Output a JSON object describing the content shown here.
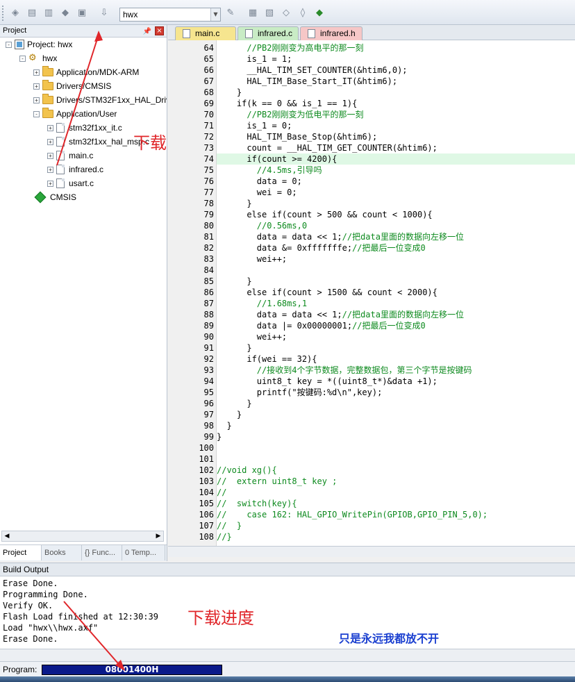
{
  "toolbar": {
    "target_value": "hwx",
    "icons": [
      "load-icon",
      "save-icon",
      "save-all-icon",
      "batch-icon",
      "print-icon",
      "lock-icon",
      "download-icon",
      "magic-wand-icon",
      "settings-icon",
      "manage-icon",
      "pack-icon",
      "options-icon",
      "debug-icon"
    ]
  },
  "project_panel": {
    "title": "Project",
    "tree": [
      {
        "label": "Project: hwx",
        "level": 0,
        "icon": "project-icon",
        "expander": "-"
      },
      {
        "label": "hwx",
        "level": 1,
        "icon": "gear-icon",
        "expander": "-"
      },
      {
        "label": "Application/MDK-ARM",
        "level": 2,
        "icon": "folder-icon",
        "expander": "+"
      },
      {
        "label": "Drivers/CMSIS",
        "level": 2,
        "icon": "folder-icon",
        "expander": "+"
      },
      {
        "label": "Drivers/STM32F1xx_HAL_Driv",
        "level": 2,
        "icon": "folder-icon",
        "expander": "+"
      },
      {
        "label": "Application/User",
        "level": 2,
        "icon": "folder-icon",
        "expander": "-"
      },
      {
        "label": "stm32f1xx_it.c",
        "level": 3,
        "icon": "file-icon",
        "expander": "+"
      },
      {
        "label": "stm32f1xx_hal_msp.c",
        "level": 3,
        "icon": "file-icon",
        "expander": "+"
      },
      {
        "label": "main.c",
        "level": 3,
        "icon": "file-icon",
        "expander": "+"
      },
      {
        "label": "infrared.c",
        "level": 3,
        "icon": "file-icon",
        "expander": "+"
      },
      {
        "label": "usart.c",
        "level": 3,
        "icon": "file-icon",
        "expander": "+"
      },
      {
        "label": "CMSIS",
        "level": 2,
        "icon": "diamond-icon",
        "expander": ""
      }
    ],
    "tabs": [
      "Project",
      "Books",
      "{} Func...",
      "0 Temp..."
    ]
  },
  "editor": {
    "tabs": [
      {
        "label": "main.c",
        "color": "#f6e58f"
      },
      {
        "label": "infrared.c",
        "color": "#c9ecc5"
      },
      {
        "label": "infrared.h",
        "color": "#f6c7c7"
      }
    ],
    "lines": [
      {
        "n": "64",
        "text": "      //PB2刚刚变为高电平的那一刻",
        "kind": "comment"
      },
      {
        "n": "65",
        "text": "      is_1 = 1;",
        "kind": "code"
      },
      {
        "n": "66",
        "text": "      __HAL_TIM_SET_COUNTER(&htim6,0);",
        "kind": "code"
      },
      {
        "n": "67",
        "text": "      HAL_TIM_Base_Start_IT(&htim6);",
        "kind": "code"
      },
      {
        "n": "68",
        "text": "    }",
        "kind": "code"
      },
      {
        "n": "69",
        "text": "    if(k == 0 && is_1 == 1){",
        "kind": "code"
      },
      {
        "n": "70",
        "text": "      //PB2刚刚变为低电平的那一刻",
        "kind": "comment"
      },
      {
        "n": "71",
        "text": "      is_1 = 0;",
        "kind": "code"
      },
      {
        "n": "72",
        "text": "      HAL_TIM_Base_Stop(&htim6);",
        "kind": "code"
      },
      {
        "n": "73",
        "text": "      count = __HAL_TIM_GET_COUNTER(&htim6);",
        "kind": "code"
      },
      {
        "n": "74",
        "text": "      if(count >= 4200){",
        "kind": "code",
        "highlight": true
      },
      {
        "n": "75",
        "text": "        //4.5ms,引导吗",
        "kind": "comment"
      },
      {
        "n": "76",
        "text": "        data = 0;",
        "kind": "code"
      },
      {
        "n": "77",
        "text": "        wei = 0;",
        "kind": "code"
      },
      {
        "n": "78",
        "text": "      }",
        "kind": "code"
      },
      {
        "n": "79",
        "text": "      else if(count > 500 && count < 1000){",
        "kind": "code"
      },
      {
        "n": "80",
        "text": "        //0.56ms,0",
        "kind": "comment"
      },
      {
        "n": "81",
        "text": "        data = data << 1;//把data里面的数据向左移一位",
        "kind": "partial"
      },
      {
        "n": "82",
        "text": "        data &= 0xfffffffe;//把最后一位变成0",
        "kind": "partial"
      },
      {
        "n": "83",
        "text": "        wei++;",
        "kind": "code"
      },
      {
        "n": "84",
        "text": "",
        "kind": "code"
      },
      {
        "n": "85",
        "text": "      }",
        "kind": "code"
      },
      {
        "n": "86",
        "text": "      else if(count > 1500 && count < 2000){",
        "kind": "code"
      },
      {
        "n": "87",
        "text": "        //1.68ms,1",
        "kind": "comment"
      },
      {
        "n": "88",
        "text": "        data = data << 1;//把data里面的数据向左移一位",
        "kind": "partial"
      },
      {
        "n": "89",
        "text": "        data |= 0x00000001;//把最后一位变成0",
        "kind": "partial"
      },
      {
        "n": "90",
        "text": "        wei++;",
        "kind": "code"
      },
      {
        "n": "91",
        "text": "      }",
        "kind": "code"
      },
      {
        "n": "92",
        "text": "      if(wei == 32){",
        "kind": "code"
      },
      {
        "n": "93",
        "text": "        //接收到4个字节数据，完整数据包，第三个字节是按键码",
        "kind": "comment"
      },
      {
        "n": "94",
        "text": "        uint8_t key = *((uint8_t*)&data +1);",
        "kind": "code"
      },
      {
        "n": "95",
        "text": "        printf(\"按键码:%d\\n\",key);",
        "kind": "code"
      },
      {
        "n": "96",
        "text": "      }",
        "kind": "code"
      },
      {
        "n": "97",
        "text": "    }",
        "kind": "code"
      },
      {
        "n": "98",
        "text": "  }",
        "kind": "code"
      },
      {
        "n": "99",
        "text": "}",
        "kind": "code"
      },
      {
        "n": "100",
        "text": "",
        "kind": "code"
      },
      {
        "n": "101",
        "text": "",
        "kind": "code"
      },
      {
        "n": "102",
        "text": "//void xg(){",
        "kind": "comment"
      },
      {
        "n": "103",
        "text": "//  extern uint8_t key ;",
        "kind": "comment"
      },
      {
        "n": "104",
        "text": "//",
        "kind": "comment"
      },
      {
        "n": "105",
        "text": "//  switch(key){",
        "kind": "comment"
      },
      {
        "n": "106",
        "text": "//    case 162: HAL_GPIO_WritePin(GPIOB,GPIO_PIN_5,0);",
        "kind": "comment"
      },
      {
        "n": "107",
        "text": "//  }",
        "kind": "comment"
      },
      {
        "n": "108",
        "text": "//}",
        "kind": "comment"
      }
    ]
  },
  "build_output": {
    "title": "Build Output",
    "lines": [
      "Erase Done.",
      "Programming Done.",
      "Verify OK.",
      "Flash Load finished at 12:30:39",
      "Load \"hwx\\\\hwx.axf\"",
      "Erase Done."
    ]
  },
  "status": {
    "program_label": "Program:",
    "progress_text": "08001400H"
  },
  "annotations": {
    "download": "下载",
    "download_progress": "下载进度",
    "lyric": "只是永远我都放不开"
  },
  "colors": {
    "comment": "#0d8a1e",
    "annotation": "#e0262a",
    "progress_bar": "#0a1a8a",
    "highlight_line": "#dff8e5"
  }
}
